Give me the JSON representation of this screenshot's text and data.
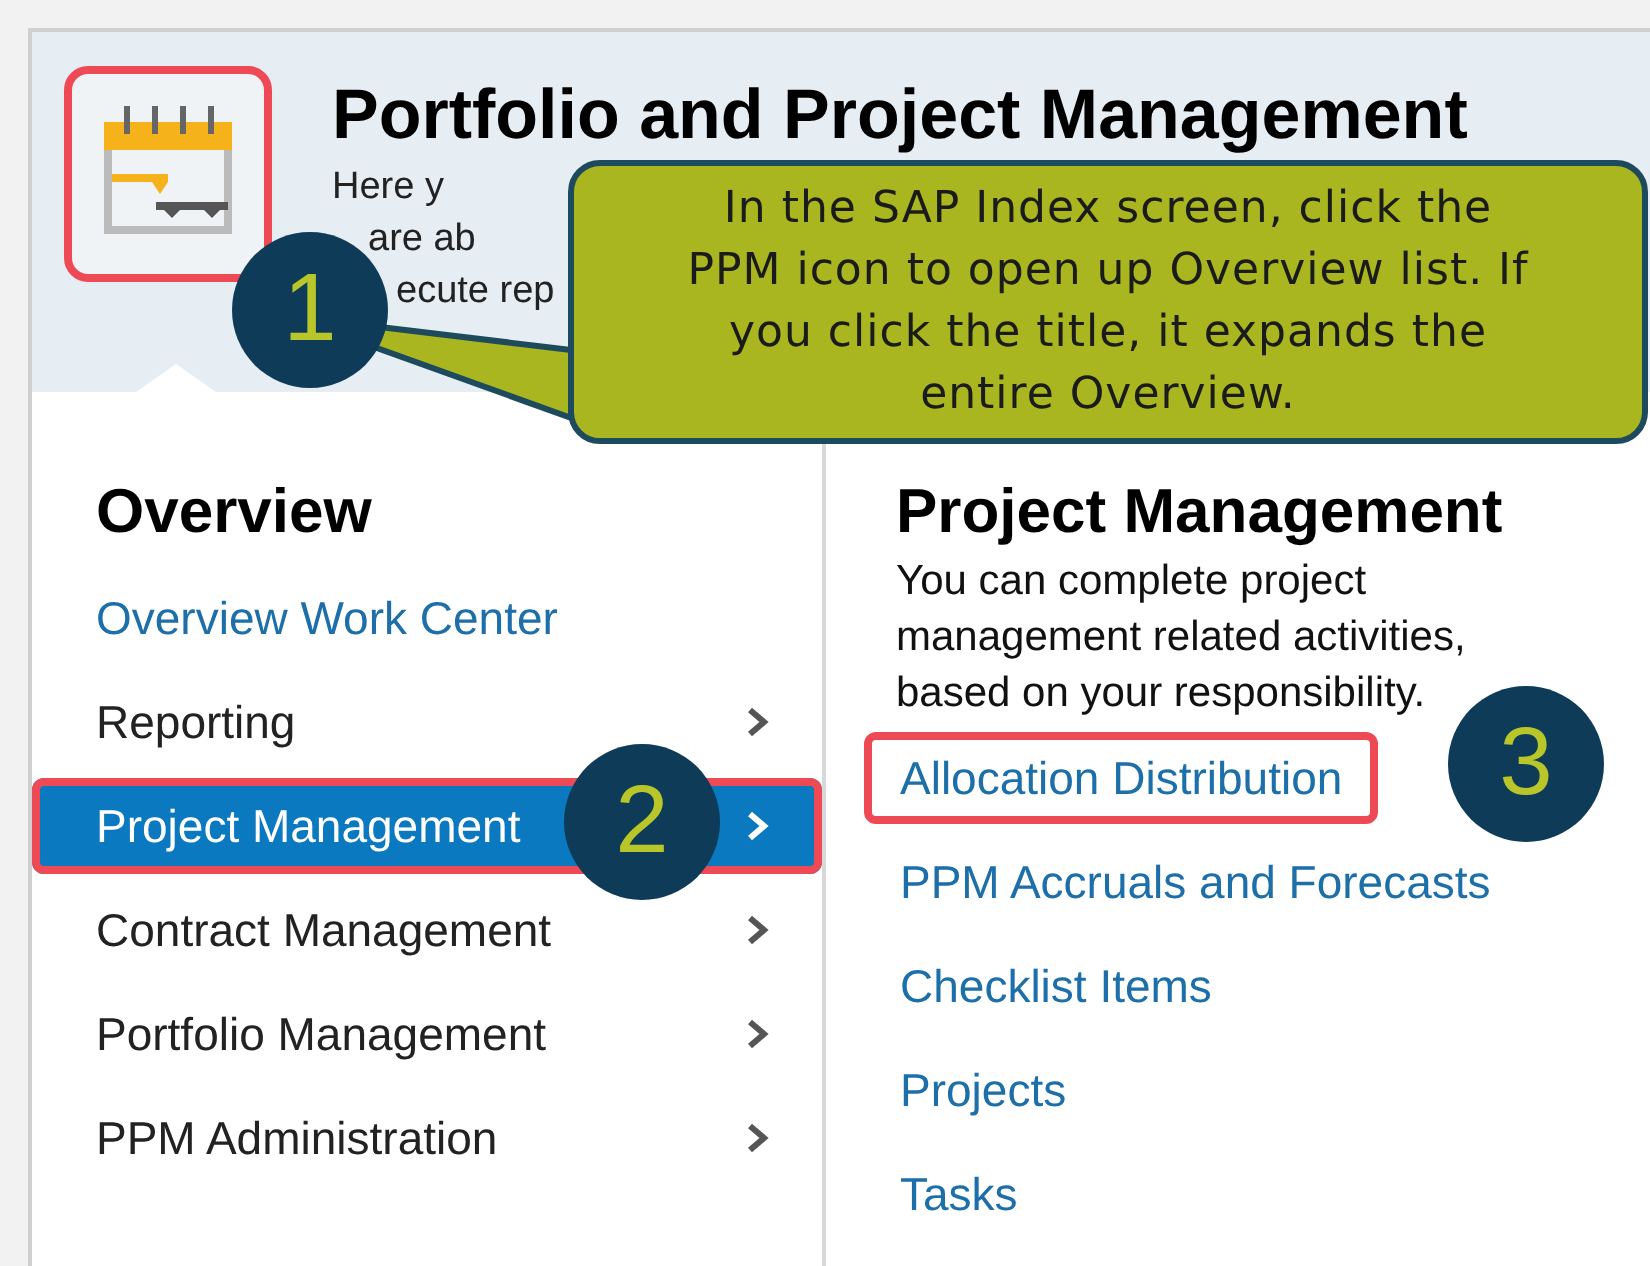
{
  "header": {
    "title": "Portfolio and Project Management",
    "subtitle_fragments": [
      "Here y",
      "are ab",
      "ecute rep"
    ],
    "icon": {
      "highlighted": true,
      "badge": "1"
    },
    "callout": "In the SAP Index screen, click the PPM icon to open up Overview list. If you click the title, it expands the entire Overview."
  },
  "overview": {
    "heading": "Overview",
    "items": [
      {
        "label": "Overview Work Center",
        "kind": "link",
        "selected": false,
        "highlighted": false
      },
      {
        "label": "Reporting",
        "kind": "menu",
        "selected": false,
        "highlighted": false
      },
      {
        "label": "Project Management",
        "kind": "menu",
        "selected": true,
        "highlighted": true,
        "badge": "2"
      },
      {
        "label": "Contract Management",
        "kind": "menu",
        "selected": false,
        "highlighted": false
      },
      {
        "label": "Portfolio Management",
        "kind": "menu",
        "selected": false,
        "highlighted": false
      },
      {
        "label": "PPM Administration",
        "kind": "menu",
        "selected": false,
        "highlighted": false
      }
    ]
  },
  "detail": {
    "heading": "Project Management",
    "description": "You can complete project management related activities, based on your responsibility.",
    "links": [
      {
        "label": "Allocation Distribution",
        "highlighted": true,
        "badge": "3"
      },
      {
        "label": "PPM Accruals and Forecasts",
        "highlighted": false
      },
      {
        "label": "Checklist Items",
        "highlighted": false
      },
      {
        "label": "Projects",
        "highlighted": false
      },
      {
        "label": "Tasks",
        "highlighted": false
      }
    ]
  }
}
